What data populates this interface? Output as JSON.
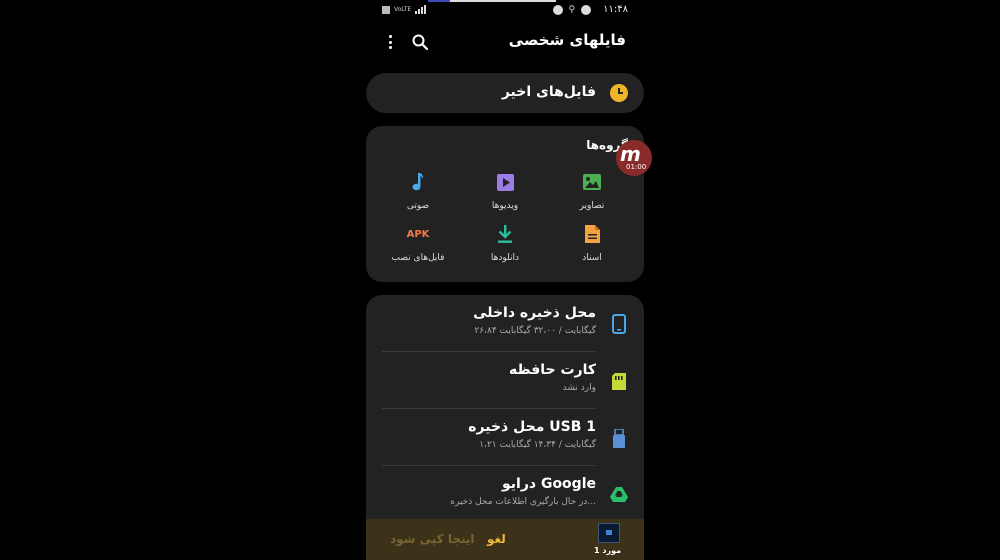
{
  "status_bar": {
    "left_text": "VoLTE",
    "time": "۱۱:۴۸"
  },
  "header": {
    "title": "فایلهای شخصی"
  },
  "recent": {
    "label": "فایل‌های اخیر"
  },
  "categories": {
    "title": "گروه‌ها",
    "items": [
      {
        "label": "تصاویر",
        "icon": "image-icon",
        "color": "#4caf50"
      },
      {
        "label": "ویدیوها",
        "icon": "video-icon",
        "color": "#9b7ce6"
      },
      {
        "label": "صوتی",
        "icon": "music-icon",
        "color": "#4aa8e8"
      },
      {
        "label": "اسناد",
        "icon": "document-icon",
        "color": "#f5a142"
      },
      {
        "label": "دانلودها",
        "icon": "download-icon",
        "color": "#2bbf9e"
      },
      {
        "label": "فایل‌های نصب",
        "icon": "apk-icon",
        "icon_text": "APK",
        "color": "#f07a4a"
      }
    ]
  },
  "recorder_badge": {
    "letter": "m",
    "time": "01:00"
  },
  "storage": {
    "items": [
      {
        "name": "محل ذخیره داخلی",
        "detail": "۲۶،۸۴ گیگابایت / ۳۲،۰۰ گیگابایت",
        "icon": "phone-icon",
        "color": "#4aa8e8"
      },
      {
        "name": "کارت حافظه",
        "detail": "وارد نشد",
        "icon": "sd-card-icon",
        "color": "#c6d83a"
      },
      {
        "name": "محل ذخیره USB 1",
        "detail": "۱،۲۱ گیگابایت / ۱۴،۳۴ گیگابایت",
        "icon": "usb-icon",
        "color": "#5b8fd6"
      },
      {
        "name": "درایو Google",
        "detail": "در حال بارگیری اطلاعات محل ذخیره...",
        "icon": "google-drive-icon",
        "color": "#2bbf6a"
      }
    ]
  },
  "bottom_bar": {
    "count": "1 مورد",
    "cancel": "لغو",
    "copy_here": "اینجا کپی شود"
  }
}
